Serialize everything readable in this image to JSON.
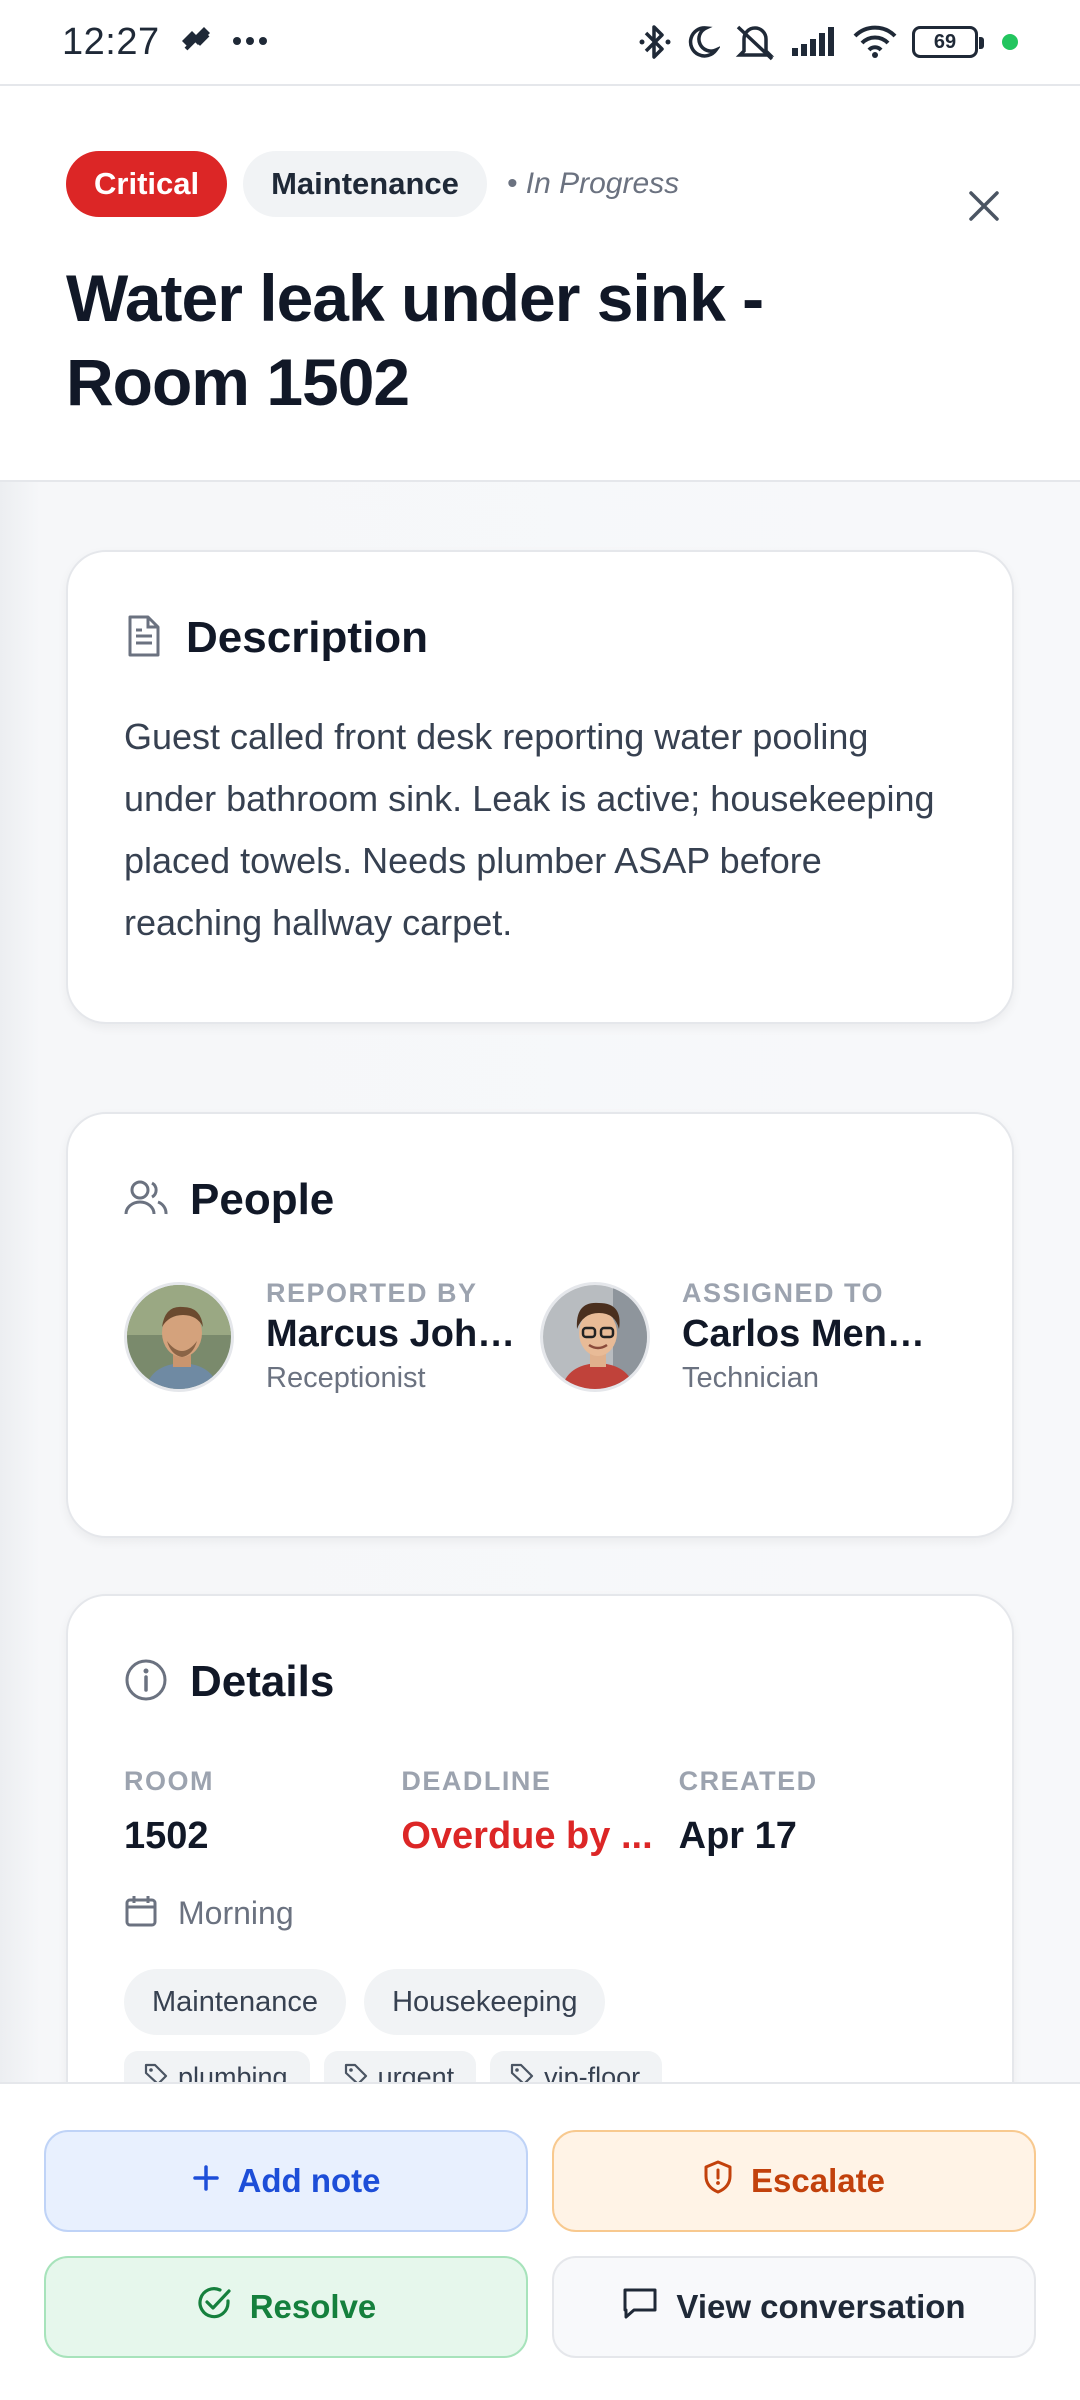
{
  "status_bar": {
    "time": "12:27",
    "battery": "69"
  },
  "header": {
    "priority": "Critical",
    "category": "Maintenance",
    "status": "• In Progress",
    "title_line1": "Water leak under sink -",
    "title_line2": "Room 1502"
  },
  "description": {
    "title": "Description",
    "text": "Guest called front desk reporting water pooling under bathroom sink. Leak is active; housekeeping placed towels. Needs plumber ASAP before reaching hallway carpet."
  },
  "people": {
    "title": "People",
    "reported_by": {
      "label": "REPORTED BY",
      "name": "Marcus Johnson",
      "role": "Receptionist"
    },
    "assigned_to": {
      "label": "ASSIGNED TO",
      "name": "Carlos Mendoza",
      "role": "Technician"
    }
  },
  "details": {
    "title": "Details",
    "room_label": "ROOM",
    "room_value": "1502",
    "deadline_label": "DEADLINE",
    "deadline_value": "Overdue by ...",
    "created_label": "CREATED",
    "created_value": "Apr 17",
    "shift": "Morning",
    "departments": [
      "Maintenance",
      "Housekeeping"
    ],
    "keywords": [
      "plumbing",
      "urgent",
      "vip-floor"
    ]
  },
  "actions": {
    "add_note": "Add note",
    "escalate": "Escalate",
    "resolve": "Resolve",
    "view_conversation": "View conversation"
  },
  "colors": {
    "critical": "#dc2626",
    "overdue": "#dc2626",
    "add_note": "#1d4ed8",
    "escalate": "#c2410c",
    "resolve": "#15803d"
  }
}
